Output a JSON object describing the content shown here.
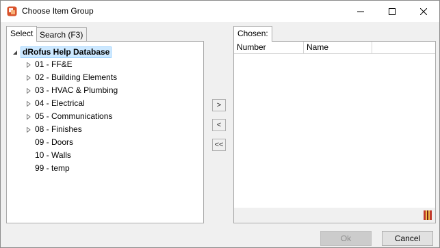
{
  "window": {
    "title": "Choose Item Group",
    "minimize_icon": "minimize-icon",
    "maximize_icon": "maximize-icon",
    "close_icon": "close-icon"
  },
  "left_tabs": [
    {
      "label": "Select",
      "active": true
    },
    {
      "label": "Search (F3)",
      "active": false
    }
  ],
  "tree": {
    "root": "dRofus Help Database",
    "items": [
      {
        "label": "01 - FF&E",
        "expandable": true
      },
      {
        "label": "02 - Building Elements",
        "expandable": true
      },
      {
        "label": "03 - HVAC & Plumbing",
        "expandable": true
      },
      {
        "label": "04 - Electrical",
        "expandable": true
      },
      {
        "label": "05 - Communications",
        "expandable": true
      },
      {
        "label": "08 - Finishes",
        "expandable": true
      },
      {
        "label": "09 - Doors",
        "expandable": false
      },
      {
        "label": "10 - Walls",
        "expandable": false
      },
      {
        "label": "99 - temp",
        "expandable": false
      }
    ]
  },
  "transfer": {
    "add": ">",
    "remove": "<",
    "remove_all": "<<"
  },
  "chosen": {
    "tab_label": "Chosen:",
    "columns": [
      "Number",
      "Name"
    ],
    "footer_icon": "book-icon"
  },
  "buttons": {
    "ok": "Ok",
    "cancel": "Cancel"
  },
  "colors": {
    "selection_bg": "#cce8ff",
    "selection_border": "#99d1ff",
    "app_icon": "#d9532b"
  }
}
